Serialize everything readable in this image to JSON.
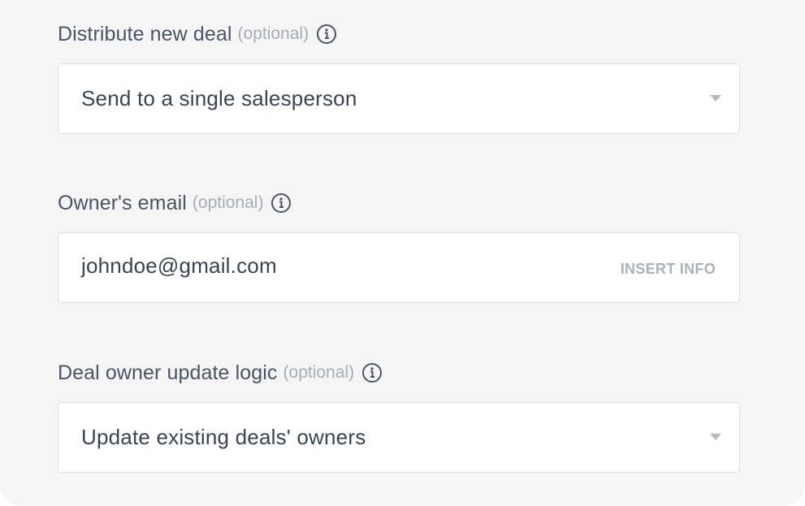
{
  "fields": [
    {
      "label": "Distribute new deal",
      "optional": "(optional)",
      "value": "Send to a single salesperson",
      "type": "select",
      "icon": "info-icon"
    },
    {
      "label": "Owner's email",
      "optional": "(optional)",
      "value": "johndoe@gmail.com",
      "type": "input",
      "action": "INSERT INFO",
      "icon": "info-icon"
    },
    {
      "label": "Deal owner update logic",
      "optional": "(optional)",
      "value": "Update existing deals' owners",
      "type": "select",
      "icon": "info-icon"
    }
  ],
  "colors": {
    "background": "#f5f5f5",
    "label": "#4a5564",
    "optional": "#a5adb5",
    "field_border": "#dde0e3",
    "value_text": "#3a4451"
  }
}
